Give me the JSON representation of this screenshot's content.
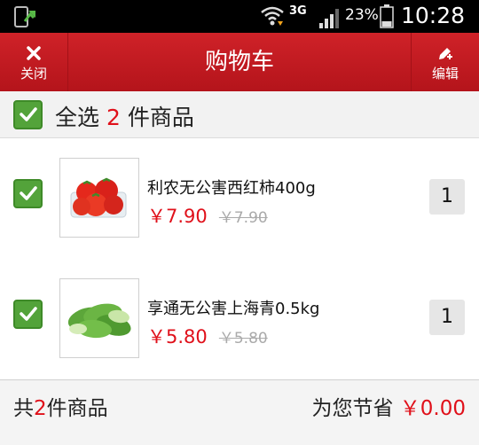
{
  "status_bar": {
    "network": "3G",
    "battery_percent": "23%",
    "time": "10:28"
  },
  "header": {
    "close_label": "关闭",
    "title": "购物车",
    "edit_label": "编辑"
  },
  "select_all": {
    "label": "全选",
    "count": "2",
    "suffix": "件商品",
    "checked": true
  },
  "items": [
    {
      "name": "利农无公害西红柿400g",
      "price": "￥7.90",
      "original_price": "￥7.90",
      "quantity": "1",
      "checked": true,
      "icon": "tomato-image"
    },
    {
      "name": "享通无公害上海青0.5kg",
      "price": "￥5.80",
      "original_price": "￥5.80",
      "quantity": "1",
      "checked": true,
      "icon": "bok-choy-image"
    }
  ],
  "footer": {
    "count_prefix": "共",
    "count": "2",
    "count_suffix": "件商品",
    "save_label": "为您节省",
    "save_amount": "￥0.00"
  },
  "colors": {
    "header_red": "#c41a21",
    "accent_red": "#e0101a",
    "check_green": "#53a33a"
  }
}
